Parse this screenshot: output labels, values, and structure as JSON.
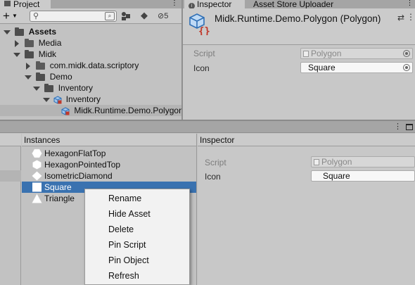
{
  "project": {
    "tab": "Project",
    "add_label": "+",
    "hidden_count": "5",
    "tree": [
      {
        "label": "Assets"
      },
      {
        "label": "Media"
      },
      {
        "label": "Midk"
      },
      {
        "label": "com.midk.data.scriptory"
      },
      {
        "label": "Demo"
      },
      {
        "label": "Inventory"
      },
      {
        "label": "Inventory"
      },
      {
        "label": "Midk.Runtime.Demo.Polygon"
      }
    ]
  },
  "inspector_top": {
    "tabs": [
      "Inspector",
      "Asset Store Uploader"
    ],
    "title": "Midk.Runtime.Demo.Polygon (Polygon)",
    "fields": [
      {
        "label": "Script",
        "value": "Polygon"
      },
      {
        "label": "Icon",
        "value": "Square"
      }
    ]
  },
  "instances": {
    "header": "Instances",
    "items": [
      {
        "label": "HexagonFlatTop",
        "icon": "hexagon-flat-icon"
      },
      {
        "label": "HexagonPointedTop",
        "icon": "hexagon-pointed-icon"
      },
      {
        "label": "IsometricDiamond",
        "icon": "diamond-icon"
      },
      {
        "label": "Square",
        "icon": "square-icon"
      },
      {
        "label": "Triangle",
        "icon": "triangle-icon"
      }
    ]
  },
  "inspector_bottom": {
    "header": "Inspector",
    "fields": [
      {
        "label": "Script",
        "value": "Polygon"
      },
      {
        "label": "Icon",
        "value": "Square"
      }
    ]
  },
  "context_menu": {
    "items": [
      "Rename",
      "Hide Asset",
      "Delete",
      "Pin Script",
      "Pin Object",
      "Refresh"
    ]
  },
  "colors": {
    "selection": "#3a72b0",
    "panel": "#c2c2c2",
    "header": "#cbcbcb"
  }
}
